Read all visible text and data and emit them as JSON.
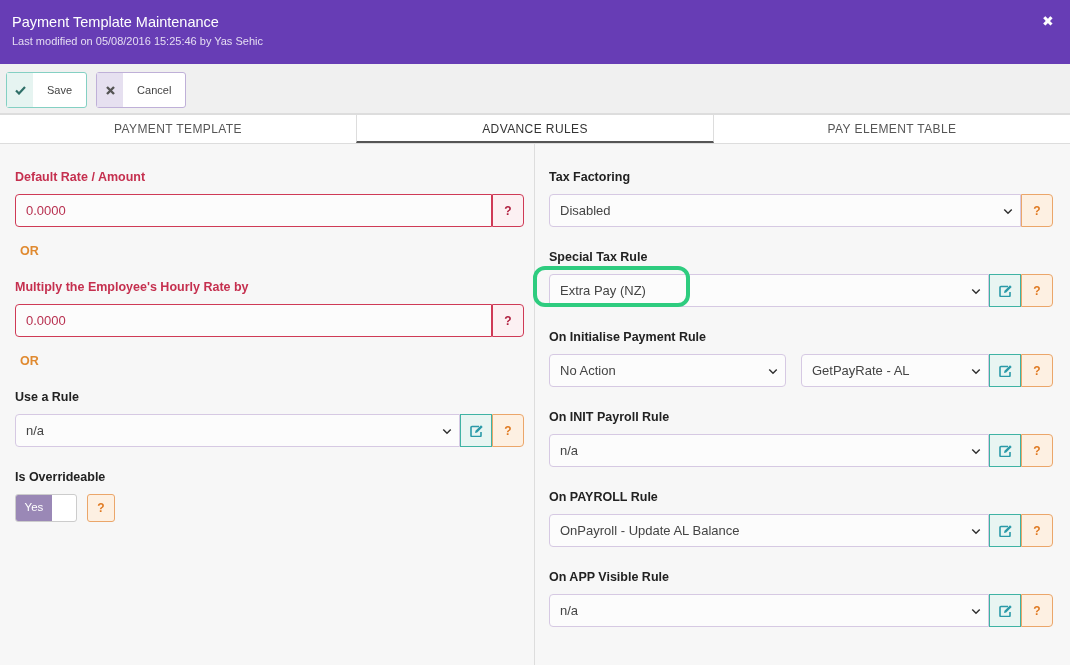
{
  "window": {
    "title": "Payment Template Maintenance",
    "subtitle": "Last modified on 05/08/2016 15:25:46 by Yas Sehic",
    "close": "✖"
  },
  "toolbar": [
    {
      "kind": "save",
      "label": "Save"
    },
    {
      "kind": "cancel",
      "label": "Cancel"
    }
  ],
  "tabs": [
    {
      "label": "PAYMENT TEMPLATE",
      "selected": false
    },
    {
      "label": "ADVANCE RULES",
      "selected": true
    },
    {
      "label": "PAY ELEMENT TABLE",
      "selected": false
    }
  ],
  "left": [
    {
      "kind": "input",
      "label": "Default Rate / Amount",
      "value": "0.0000",
      "required": true,
      "help": "?"
    },
    {
      "kind": "or",
      "label": "OR"
    },
    {
      "kind": "input",
      "label": "Multiply the Employee's Hourly Rate by",
      "value": "0.0000",
      "required": true,
      "help": "?"
    },
    {
      "kind": "or",
      "label": "OR"
    },
    {
      "kind": "select",
      "label": "Use a Rule",
      "values": [
        "n/a"
      ],
      "editable": true,
      "help": "?"
    },
    {
      "kind": "toggle",
      "label": "Is Overrideable",
      "on": true,
      "on_text": "Yes",
      "help": "?"
    }
  ],
  "right": [
    {
      "kind": "select",
      "label": "Tax Factoring",
      "values": [
        "Disabled"
      ],
      "editable": false,
      "help": "?"
    },
    {
      "kind": "select",
      "label": "Special Tax Rule",
      "values": [
        "Extra Pay (NZ)"
      ],
      "editable": true,
      "highlighted": true,
      "help": "?"
    },
    {
      "kind": "select",
      "label": "On Initialise Payment Rule",
      "values": [
        "No Action",
        "GetPayRate - AL"
      ],
      "editable": true,
      "help": "?"
    },
    {
      "kind": "select",
      "label": "On INIT Payroll Rule",
      "values": [
        "n/a"
      ],
      "editable": true,
      "help": "?"
    },
    {
      "kind": "select",
      "label": "On PAYROLL Rule",
      "values": [
        "OnPayroll - Update AL Balance"
      ],
      "editable": true,
      "help": "?"
    },
    {
      "kind": "select",
      "label": "On APP Visible Rule",
      "values": [
        "n/a"
      ],
      "editable": true,
      "help": "?"
    }
  ]
}
